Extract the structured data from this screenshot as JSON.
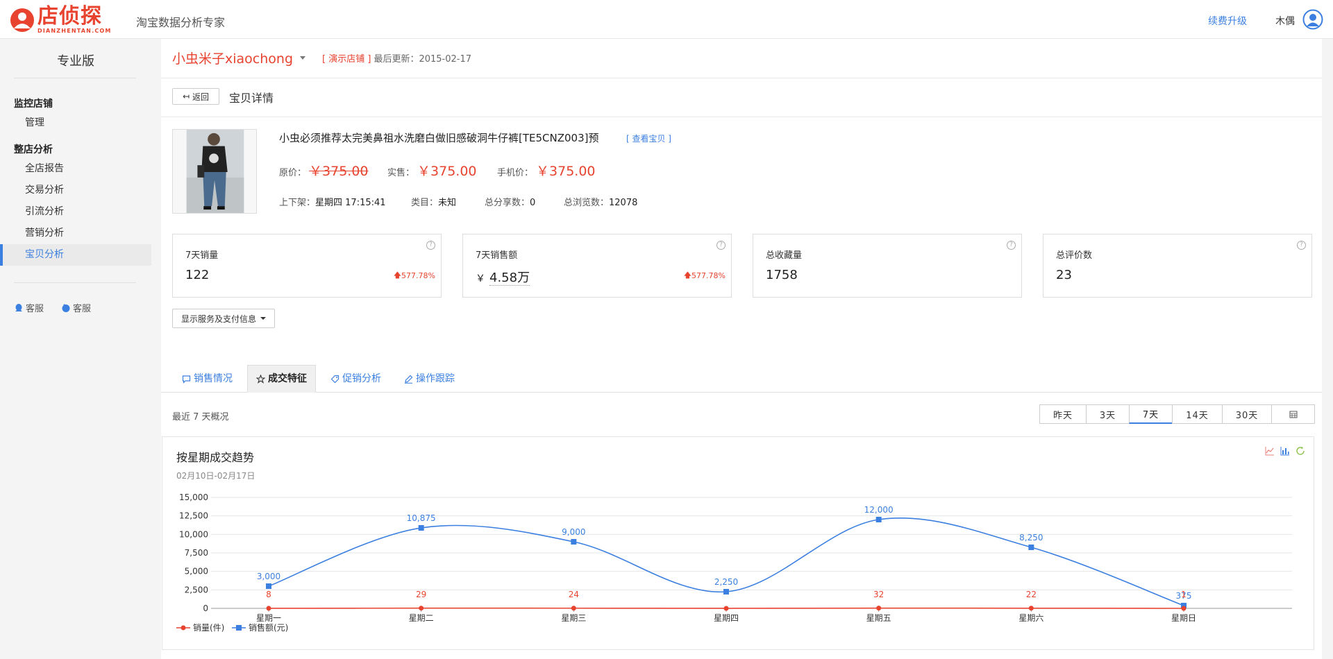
{
  "header": {
    "logo_text": "店侦探",
    "logo_sub": "DIANZHENTAN.COM",
    "tagline": "淘宝数据分析专家",
    "renew_label": "续费升级",
    "username": "木偶"
  },
  "sidebar": {
    "title": "专业版",
    "group_monitor": "监控店铺",
    "manage": "管理",
    "group_analysis": "整店分析",
    "items": [
      {
        "label": "全店报告"
      },
      {
        "label": "交易分析"
      },
      {
        "label": "引流分析"
      },
      {
        "label": "营销分析"
      },
      {
        "label": "宝贝分析"
      }
    ],
    "cs1": "客服",
    "cs2": "客服"
  },
  "shop": {
    "name": "小虫米子xiaochong",
    "demo_tag": "[ 演示店铺 ]",
    "last_update": "最后更新：2015-02-17"
  },
  "detail": {
    "back_label": "返回",
    "title": "宝贝详情"
  },
  "product": {
    "name": "小虫必须推荐太完美鼻祖水洗磨白做旧感破洞牛仔裤[TE5CNZ003]预",
    "view_link": "[ 查看宝贝 ]",
    "orig_label": "原价：",
    "orig_price": "￥375.00",
    "real_label": "实售：",
    "real_price": "￥375.00",
    "mobile_label": "手机价：",
    "mobile_price": "￥375.00",
    "shelf_label": "上下架：",
    "shelf_value": "星期四 17:15:41",
    "category_label": "类目：",
    "category_value": "未知",
    "share_label": "总分享数：",
    "share_value": "0",
    "views_label": "总浏览数：",
    "views_value": "12078"
  },
  "stats": [
    {
      "label": "7天销量",
      "value": "122",
      "change": "577.78%"
    },
    {
      "label": "7天销售额",
      "yen": "￥",
      "value": "4.58万",
      "change": "577.78%"
    },
    {
      "label": "总收藏量",
      "value": "1758"
    },
    {
      "label": "总评价数",
      "value": "23"
    }
  ],
  "service_btn": "显示服务及支付信息",
  "tabs": [
    {
      "label": "销售情况"
    },
    {
      "label": "成交特征"
    },
    {
      "label": "促销分析"
    },
    {
      "label": "操作跟踪"
    }
  ],
  "overview_label": "最近 7 天概况",
  "ranges": [
    "昨天",
    "3天",
    "7天",
    "14天",
    "30天"
  ],
  "chart_data": {
    "type": "line",
    "title": "按星期成交趋势",
    "subtitle": "02月10日-02月17日",
    "categories": [
      "星期一",
      "星期二",
      "星期三",
      "星期四",
      "星期五",
      "星期六",
      "星期日"
    ],
    "ylim": [
      0,
      15000
    ],
    "yticks": [
      "0",
      "2,500",
      "5,000",
      "7,500",
      "10,000",
      "12,500",
      "15,000"
    ],
    "series": [
      {
        "name": "销量(件)",
        "color": "#e8432f",
        "values": [
          8,
          29,
          24,
          2,
          32,
          22,
          1
        ],
        "labels": [
          "8",
          "29",
          "24",
          "",
          "32",
          "22",
          "1"
        ]
      },
      {
        "name": "销售额(元)",
        "color": "#3b7fe0",
        "values": [
          3000,
          10875,
          9000,
          2250,
          12000,
          8250,
          375
        ],
        "labels": [
          "3,000",
          "10,875",
          "9,000",
          "2,250",
          "12,000",
          "8,250",
          "375"
        ]
      }
    ],
    "grid": true,
    "legend": "bottom-left"
  }
}
